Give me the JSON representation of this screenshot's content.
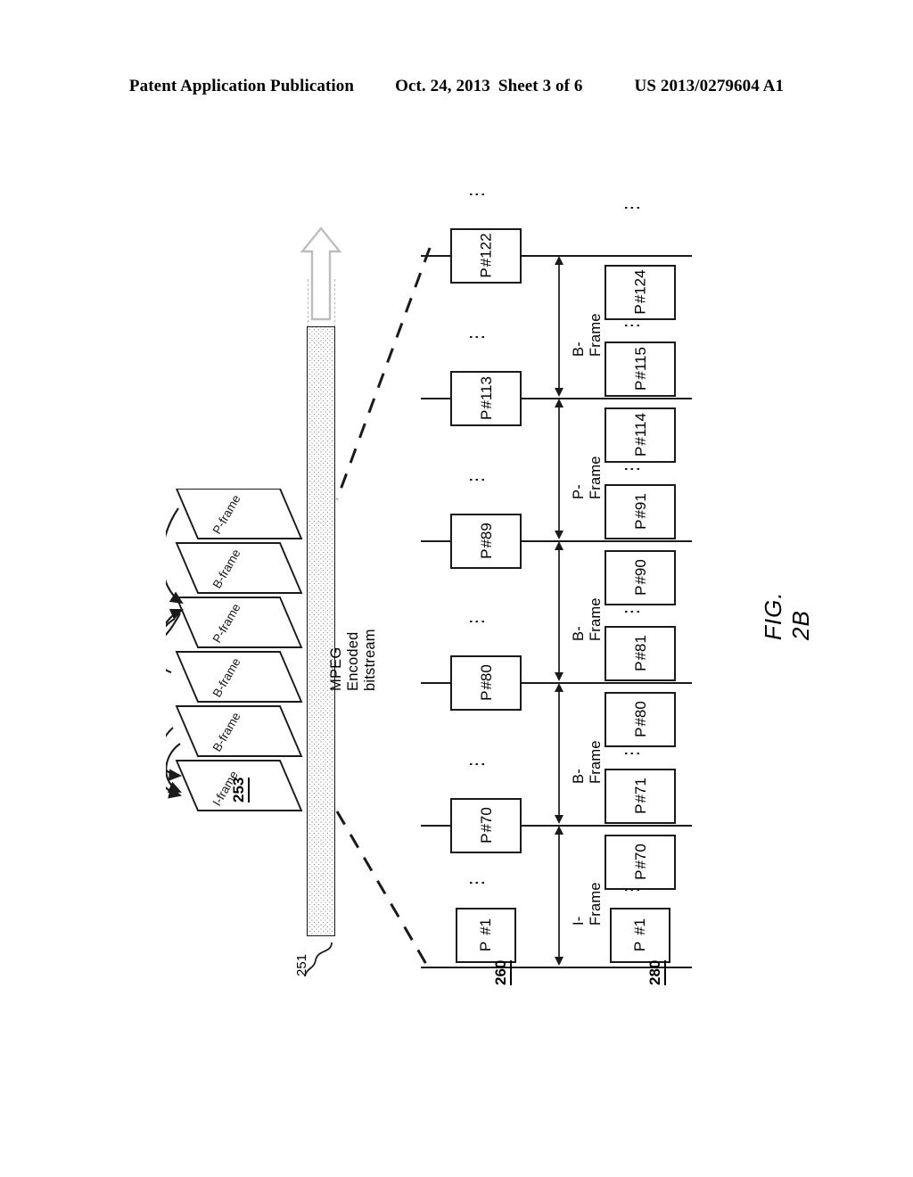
{
  "header": {
    "publication": "Patent Application Publication",
    "date": "Oct. 24, 2013",
    "sheet": "Sheet 3 of 6",
    "number": "US 2013/0279604 A1"
  },
  "figure": {
    "label": "FIG. 2B",
    "bitstream": {
      "caption": "MPEG Encoded bitstream",
      "reference": "251",
      "arrow_icon": "up-block-arrow"
    },
    "frame_stack": {
      "reference": "253",
      "frames": [
        {
          "label": "P-frame"
        },
        {
          "label": "B-frame"
        },
        {
          "label": "P-frame"
        },
        {
          "label": "B-frame"
        },
        {
          "label": "B-frame"
        },
        {
          "label": "I-frame"
        }
      ]
    },
    "columns": [
      {
        "reference": "260"
      },
      {
        "reference": "280"
      }
    ],
    "dots_glyph": "⋮",
    "column_260_boxes": [
      {
        "type": "P",
        "number": "#122",
        "single_line": false
      },
      {
        "type": "P",
        "number": "#113",
        "single_line": false
      },
      {
        "type": "P",
        "number": "#89",
        "single_line": false
      },
      {
        "type": "P",
        "number": "#80",
        "single_line": false
      },
      {
        "type": "P",
        "number": "#70",
        "single_line": false
      },
      {
        "type": "P",
        "number": "#1",
        "single_line": true
      }
    ],
    "column_280_boxes": [
      {
        "type": "P",
        "number": "#124",
        "single_line": false
      },
      {
        "type": "P",
        "number": "#115",
        "single_line": false
      },
      {
        "type": "P",
        "number": "#114",
        "single_line": false
      },
      {
        "type": "P",
        "number": "#91",
        "single_line": false
      },
      {
        "type": "P",
        "number": "#90",
        "single_line": false
      },
      {
        "type": "P",
        "number": "#81",
        "single_line": false
      },
      {
        "type": "P",
        "number": "#80",
        "single_line": false
      },
      {
        "type": "P",
        "number": "#71",
        "single_line": false
      },
      {
        "type": "P",
        "number": "#70",
        "single_line": false
      },
      {
        "type": "P",
        "number": "#1",
        "single_line": true
      }
    ],
    "interval_labels": [
      {
        "label": "B-Frame"
      },
      {
        "label": "P-Frame"
      },
      {
        "label": "B-Frame"
      },
      {
        "label": "B-Frame"
      },
      {
        "label": "I-Frame"
      }
    ]
  },
  "colors": {
    "ink": "#1a1a1a",
    "stipple": "#8a8a8a",
    "guide": "#b9b9b9",
    "arrow_outline": "#bdbdbd"
  }
}
